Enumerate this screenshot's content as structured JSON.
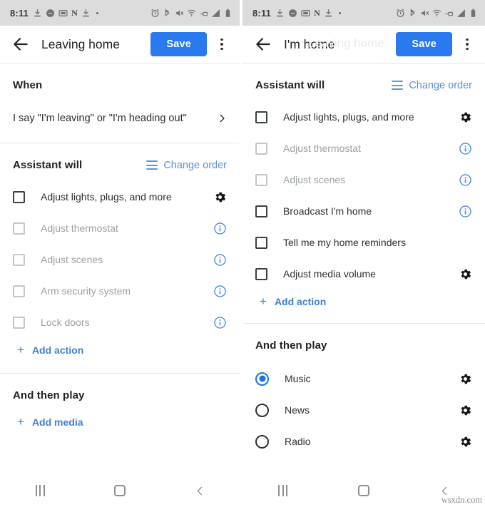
{
  "status_bar": {
    "time": "8:11",
    "left_icons": [
      "download-icon",
      "message-icon",
      "screenshot-icon",
      "netflix-n-icon",
      "download-icon-2",
      "dot-icon"
    ],
    "right_icons": [
      "alarm-icon",
      "bluetooth-icon",
      "mute-icon",
      "wifi-icon",
      "vpn-key-icon",
      "signal-icon",
      "battery-icon"
    ],
    "background": "#dcdcdc"
  },
  "colors": {
    "accent_blue": "#2979ef",
    "link_blue": "#3f7fd4",
    "info_blue": "#4285f4",
    "dim_text": "#9aa0a6",
    "text": "#2e2e2e"
  },
  "left_screen": {
    "appbar": {
      "back_label": "back-arrow",
      "title": "Leaving home",
      "ghost_title": "Leaving home",
      "save_label": "Save",
      "overflow_label": "more-options"
    },
    "when_section": {
      "title": "When",
      "trigger_text": "I say \"I'm leaving\" or \"I'm heading out\""
    },
    "assistant_section": {
      "title": "Assistant will",
      "change_order_label": "Change order",
      "actions": [
        {
          "label": "Adjust lights, plugs, and more",
          "checked": false,
          "dim": false,
          "trailing": "gear-icon"
        },
        {
          "label": "Adjust thermostat",
          "checked": false,
          "dim": true,
          "trailing": "info-icon"
        },
        {
          "label": "Adjust scenes",
          "checked": false,
          "dim": true,
          "trailing": "info-icon"
        },
        {
          "label": "Arm security system",
          "checked": false,
          "dim": true,
          "trailing": "info-icon"
        },
        {
          "label": "Lock doors",
          "checked": false,
          "dim": true,
          "trailing": "info-icon"
        }
      ],
      "add_label": "Add action"
    },
    "play_section": {
      "title": "And then play",
      "add_label": "Add media"
    }
  },
  "right_screen": {
    "appbar": {
      "back_label": "back-arrow",
      "title": "I'm home",
      "ghost_title": "Leaving home",
      "save_label": "Save",
      "overflow_label": "more-options"
    },
    "assistant_section": {
      "title": "Assistant will",
      "change_order_label": "Change order",
      "actions": [
        {
          "label": "Adjust lights, plugs, and more",
          "checked": false,
          "dim": false,
          "trailing": "gear-icon"
        },
        {
          "label": "Adjust thermostat",
          "checked": false,
          "dim": true,
          "trailing": "info-icon"
        },
        {
          "label": "Adjust scenes",
          "checked": false,
          "dim": true,
          "trailing": "info-icon"
        },
        {
          "label": "Broadcast I'm home",
          "checked": false,
          "dim": false,
          "trailing": "info-icon"
        },
        {
          "label": "Tell me my home reminders",
          "checked": false,
          "dim": false,
          "trailing": "none"
        },
        {
          "label": "Adjust media volume",
          "checked": false,
          "dim": false,
          "trailing": "gear-icon"
        }
      ],
      "add_label": "Add action"
    },
    "play_section": {
      "title": "And then play",
      "options": [
        {
          "label": "Music",
          "selected": true,
          "trailing": "gear-icon"
        },
        {
          "label": "News",
          "selected": false,
          "trailing": "gear-icon"
        },
        {
          "label": "Radio",
          "selected": false,
          "trailing": "gear-icon"
        }
      ]
    }
  },
  "nav_bar": {
    "recent_label": "recent-apps",
    "home_label": "home",
    "back_label": "back"
  },
  "watermark": "wsxdn.com"
}
